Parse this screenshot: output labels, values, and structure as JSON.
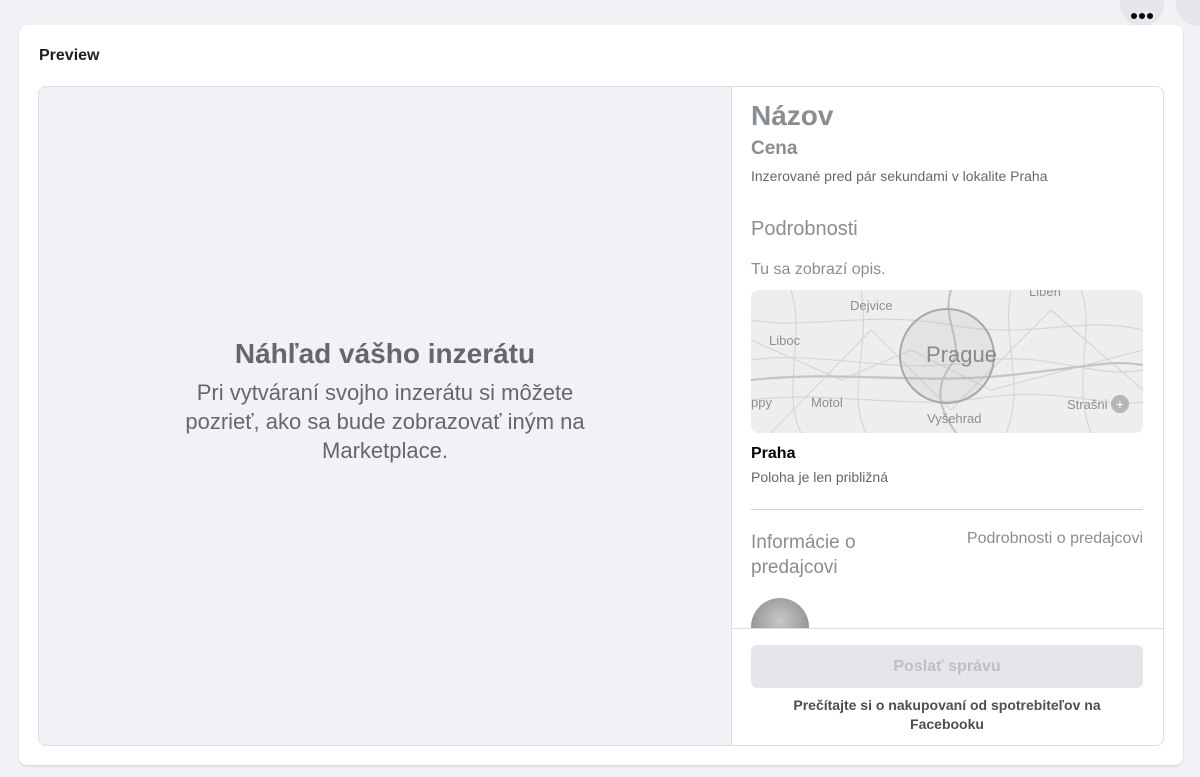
{
  "card": {
    "title": "Preview"
  },
  "preview": {
    "heading": "Náhľad vášho inzerátu",
    "description": "Pri vytváraní svojho inzerátu si môžete pozrieť, ako sa bude zobrazovať iným na Marketplace."
  },
  "listing": {
    "title": "Názov",
    "price": "Cena",
    "meta": "Inzerované pred pár sekundami v lokalite Praha",
    "details_heading": "Podrobnosti",
    "details_placeholder": "Tu sa zobrazí opis.",
    "map": {
      "city_label": "Prague",
      "districts": [
        "Dejvice",
        "Liboc",
        "Motol",
        "Vyšehrad",
        "Strašni",
        "Libeň",
        "ppy"
      ]
    },
    "location_name": "Praha",
    "location_note": "Poloha je len približná",
    "seller_heading": "Informácie o predajcovi",
    "seller_link": "Podrobnosti o predajcovi"
  },
  "footer": {
    "send_label": "Poslať správu",
    "note": "Prečítajte si o nakupovaní od spotrebiteľov na Facebooku"
  },
  "colors": {
    "page_bg": "#f0f2f5",
    "muted_text": "#8a8d91",
    "button_bg": "#e4e6eb"
  },
  "icons": [
    "more-options-icon",
    "zoom-plus-icon"
  ]
}
